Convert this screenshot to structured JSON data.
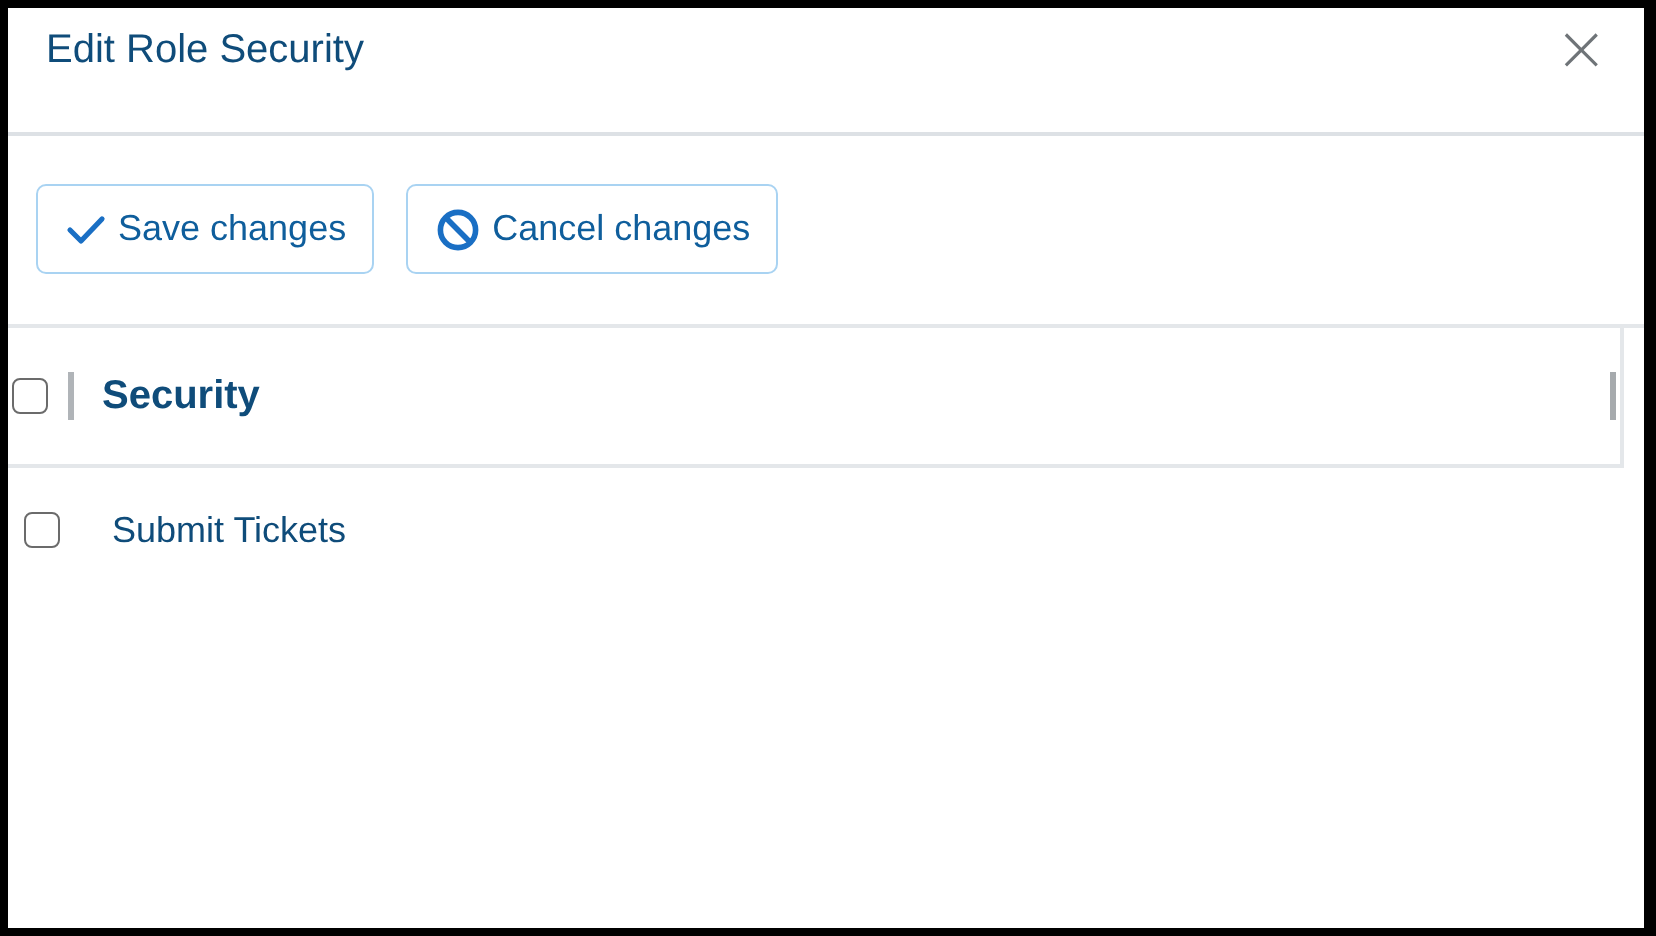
{
  "dialog": {
    "title": "Edit Role Security",
    "close": "×"
  },
  "toolbar": [
    {
      "kind": "save",
      "label": "Save changes"
    },
    {
      "kind": "cancel",
      "label": "Cancel changes"
    }
  ],
  "table": {
    "select_all_checked": false,
    "columns": [
      "Security"
    ],
    "rows": [
      {
        "name": "Submit Tickets",
        "checked": false
      }
    ]
  }
}
